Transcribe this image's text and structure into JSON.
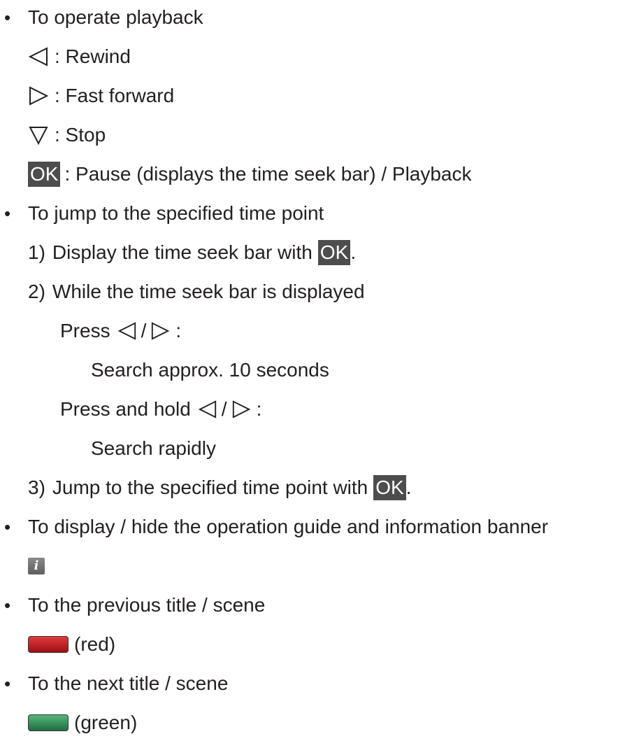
{
  "sections": {
    "playback": {
      "heading": "To operate playback",
      "rewind": ": Rewind",
      "fast_forward": ": Fast forward",
      "stop": ": Stop",
      "ok_key": "OK",
      "ok_desc": ": Pause (displays the time seek bar) / Playback"
    },
    "jump": {
      "heading": "To jump to the specified time point",
      "step1_num": "1)",
      "step1_text": "Display the time seek bar with",
      "step1_key": "OK",
      "step1_end": ".",
      "step2_num": "2)",
      "step2_text": "While the time seek bar is displayed",
      "press": "Press",
      "slash": "/",
      "colon": ":",
      "press_desc": "Search approx. 10 seconds",
      "press_hold": "Press and hold",
      "press_hold_desc": "Search rapidly",
      "step3_num": "3)",
      "step3_text": "Jump to the specified time point with",
      "step3_key": "OK",
      "step3_end": "."
    },
    "display": {
      "heading": "To display / hide the operation guide and information banner",
      "info_glyph": "i"
    },
    "previous": {
      "heading": "To the previous title / scene",
      "label": "(red)",
      "color": "#c0161c"
    },
    "next": {
      "heading": "To the next title / scene",
      "label": "(green)",
      "color": "#2f8a55"
    }
  },
  "colors": {
    "text": "#231f20",
    "ok_bg": "#4d4d4d",
    "info_bg": "#707070"
  }
}
